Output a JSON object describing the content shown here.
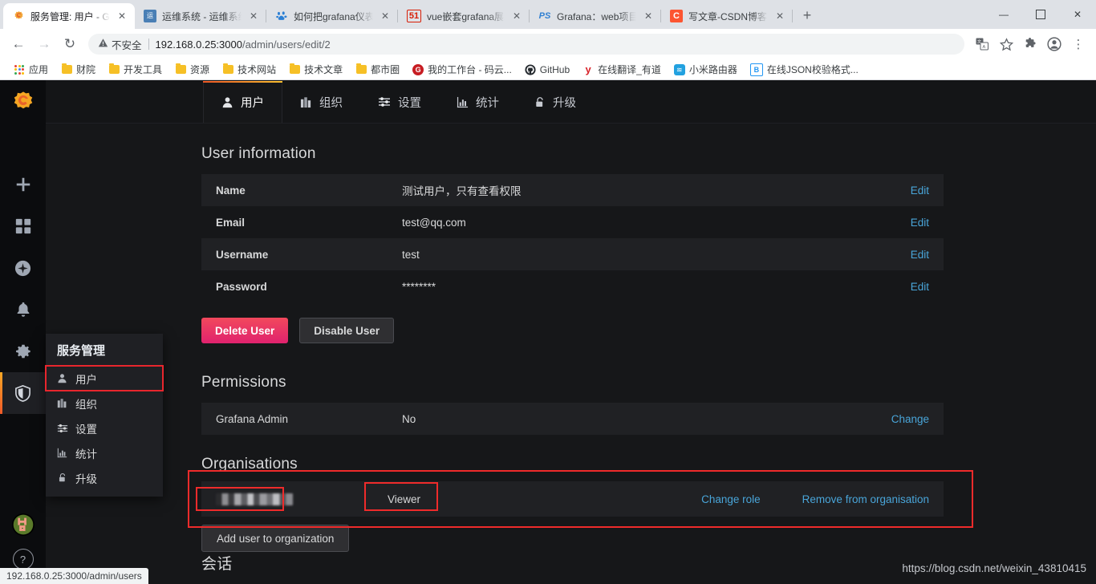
{
  "browser": {
    "tabs": [
      {
        "title": "服务管理: 用户 - Grafana",
        "favicon": "grafana-icon",
        "active": true
      },
      {
        "title": "运维系统 - 运维系统",
        "favicon": "ops-icon",
        "active": false
      },
      {
        "title": "如何把grafana仪表盘的",
        "favicon": "baidu-icon",
        "active": false
      },
      {
        "title": "vue嵌套grafana展示大",
        "favicon": "51cto-icon",
        "active": false
      },
      {
        "title": "Grafana：web项目的监",
        "favicon": "ps-icon",
        "active": false
      },
      {
        "title": "写文章-CSDN博客",
        "favicon": "csdn-icon",
        "active": false
      }
    ],
    "new_tab_label": "+",
    "window_controls": {
      "minimize": "—",
      "maximize": "☐",
      "close": "✕"
    },
    "nav": {
      "back": "←",
      "forward": "→",
      "reload": "↻",
      "security_label": "不安全",
      "security_icon": "warning-triangle-icon",
      "url_host": "192.168.0.25:3000",
      "url_path": "/admin/users/edit/2",
      "translate_icon": "translate-icon",
      "bookmark_icon": "star-icon",
      "extensions_icon": "puzzle-icon",
      "profile_icon": "profile-avatar-icon",
      "menu_icon": "three-dot-menu-icon"
    },
    "bookmarks": [
      {
        "label": "应用",
        "icon": "apps-grid-icon"
      },
      {
        "label": "财院",
        "icon": "folder-icon"
      },
      {
        "label": "开发工具",
        "icon": "folder-icon"
      },
      {
        "label": "资源",
        "icon": "folder-icon"
      },
      {
        "label": "技术网站",
        "icon": "folder-icon"
      },
      {
        "label": "技术文章",
        "icon": "folder-icon"
      },
      {
        "label": "都市圈",
        "icon": "folder-icon"
      },
      {
        "label": "我的工作台 - 码云...",
        "icon": "gitee-icon"
      },
      {
        "label": "GitHub",
        "icon": "github-icon"
      },
      {
        "label": "在线翻译_有道",
        "icon": "youdao-icon"
      },
      {
        "label": "小米路由器",
        "icon": "wifi-icon"
      },
      {
        "label": "在线JSON校验格式...",
        "icon": "bejson-icon"
      }
    ],
    "status_bar_url": "192.168.0.25:3000/admin/users"
  },
  "sidebar": {
    "logo": "grafana-logo-icon",
    "icons": [
      {
        "name": "create-icon",
        "glyph": "+"
      },
      {
        "name": "dashboards-icon",
        "glyph": "apps"
      },
      {
        "name": "explore-icon",
        "glyph": "compass"
      },
      {
        "name": "alerting-icon",
        "glyph": "bell"
      },
      {
        "name": "configuration-icon",
        "glyph": "gear"
      },
      {
        "name": "server-admin-icon",
        "glyph": "shield",
        "active": true
      }
    ],
    "avatar": "user-avatar",
    "help": "?"
  },
  "flyout": {
    "title": "服务管理",
    "items": [
      {
        "label": "用户",
        "icon": "user-icon",
        "highlighted": true
      },
      {
        "label": "组织",
        "icon": "building-icon",
        "highlighted": false
      },
      {
        "label": "设置",
        "icon": "sliders-icon",
        "highlighted": false
      },
      {
        "label": "统计",
        "icon": "bar-chart-icon",
        "highlighted": false
      },
      {
        "label": "升级",
        "icon": "lock-icon",
        "highlighted": false
      }
    ]
  },
  "page_tabs": [
    {
      "label": "用户",
      "icon": "user-icon",
      "active": true
    },
    {
      "label": "组织",
      "icon": "building-icon",
      "active": false
    },
    {
      "label": "设置",
      "icon": "sliders-icon",
      "active": false
    },
    {
      "label": "统计",
      "icon": "bar-chart-icon",
      "active": false
    },
    {
      "label": "升级",
      "icon": "lock-icon",
      "active": false
    }
  ],
  "user_information": {
    "heading": "User information",
    "rows": [
      {
        "label": "Name",
        "value": "测试用户，只有查看权限",
        "action": "Edit"
      },
      {
        "label": "Email",
        "value": "test@qq.com",
        "action": "Edit"
      },
      {
        "label": "Username",
        "value": "test",
        "action": "Edit"
      },
      {
        "label": "Password",
        "value": "********",
        "action": "Edit"
      }
    ],
    "delete_button": "Delete User",
    "disable_button": "Disable User"
  },
  "permissions": {
    "heading": "Permissions",
    "rows": [
      {
        "label": "Grafana Admin",
        "value": "No",
        "action": "Change"
      }
    ]
  },
  "organisations": {
    "heading": "Organisations",
    "rows": [
      {
        "name": "",
        "role": "Viewer",
        "change_role": "Change role",
        "remove": "Remove from organisation"
      }
    ],
    "add_button": "Add user to organization"
  },
  "sessions": {
    "heading": "会话"
  },
  "watermark": "https://blog.csdn.net/weixin_43810415",
  "colors": {
    "accent_orange": "#f05a28",
    "accent_yellow": "#fbc233",
    "link_blue": "#49a5d9",
    "danger_red": "#f2495c",
    "annotation_red": "#ef2b2b",
    "panel_bg": "#161719",
    "row_bg": "#202124"
  }
}
